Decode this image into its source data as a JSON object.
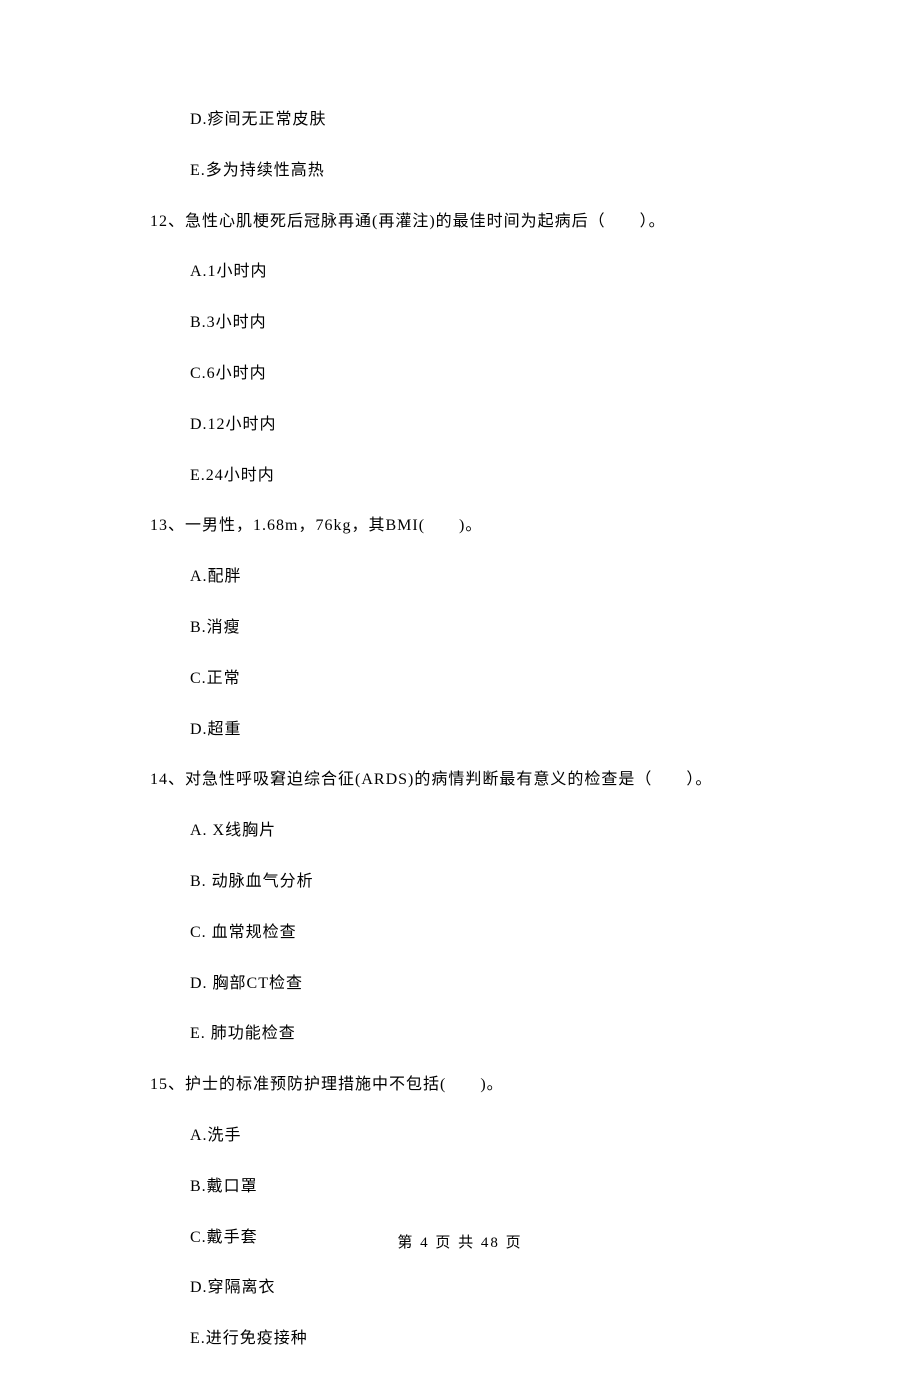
{
  "leading_options": [
    "D.疹间无正常皮肤",
    "E.多为持续性高热"
  ],
  "questions": [
    {
      "number": "12、",
      "text": "急性心肌梗死后冠脉再通(再灌注)的最佳时间为起病后（　　）。",
      "options": [
        "A.1小时内",
        "B.3小时内",
        "C.6小时内",
        "D.12小时内",
        "E.24小时内"
      ]
    },
    {
      "number": "13、",
      "text": "一男性，1.68m，76kg，其BMI(　　)。",
      "options": [
        "A.配胖",
        "B.消瘦",
        "C.正常",
        "D.超重"
      ]
    },
    {
      "number": "14、",
      "text": "对急性呼吸窘迫综合征(ARDS)的病情判断最有意义的检查是（　　）。",
      "options": [
        "A. X线胸片",
        "B. 动脉血气分析",
        "C. 血常规检查",
        "D. 胸部CT检查",
        "E. 肺功能检查"
      ]
    },
    {
      "number": "15、",
      "text": "护士的标准预防护理措施中不包括(　　)。",
      "options": [
        "A.洗手",
        "B.戴口罩",
        "C.戴手套",
        "D.穿隔离衣",
        "E.进行免疫接种"
      ]
    }
  ],
  "footer": "第 4 页 共 48 页"
}
